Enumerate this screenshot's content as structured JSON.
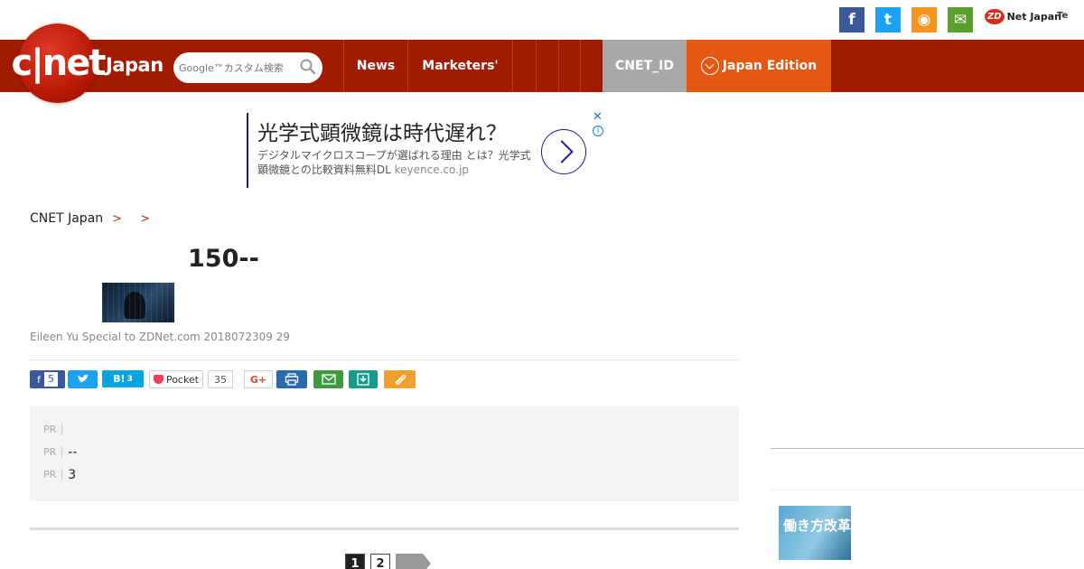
{
  "social": {
    "facebook_glyph": "f",
    "twitter_glyph": "t",
    "rss_glyph": "◉",
    "mail_glyph": "✉",
    "zdnet_badge": "ZD",
    "zdnet_label": "Net Japan",
    "tech_label": "Te"
  },
  "header": {
    "logo_text": "c|net",
    "logo_sub": "Japan",
    "search_placeholder": "Google™カスタム検索",
    "nav": [
      "News",
      "Marketers'",
      "",
      "",
      "",
      "",
      "CNET_ID",
      "Japan Edition"
    ],
    "colors": {
      "nav_bg": "#a01b00",
      "cnet_id_bg": "#a8a8a8",
      "edition_bg": "#e35812"
    }
  },
  "ad": {
    "title": "光学式顕微鏡は時代遅れ？",
    "desc": "デジタルマイクロスコープが選ばれる理由 とは？光学式顕微鏡との比較資料無料DL",
    "domain": "keyence.co.jp",
    "close": "✕",
    "info": "i"
  },
  "breadcrumb": {
    "items": [
      "CNET Japan",
      "",
      ""
    ],
    "sep": ">"
  },
  "article": {
    "headline": "150--",
    "byline": "Eileen Yu Special to ZDNet.com 2018072309 29",
    "share": {
      "fb_count": "5",
      "hatebu_label": "B!",
      "hatebu_count": "3",
      "pocket_label": "Pocket",
      "pocket_count": "35",
      "gplus_label": "G+"
    }
  },
  "pr": {
    "tag": "PR",
    "items": [
      "",
      "--",
      "3"
    ]
  },
  "pagination": {
    "pages": [
      "1",
      "2"
    ]
  },
  "sidebar": {
    "title": "",
    "thumb_text": "働き方改革",
    "head": "",
    "sub1": "",
    "sub2": ""
  }
}
